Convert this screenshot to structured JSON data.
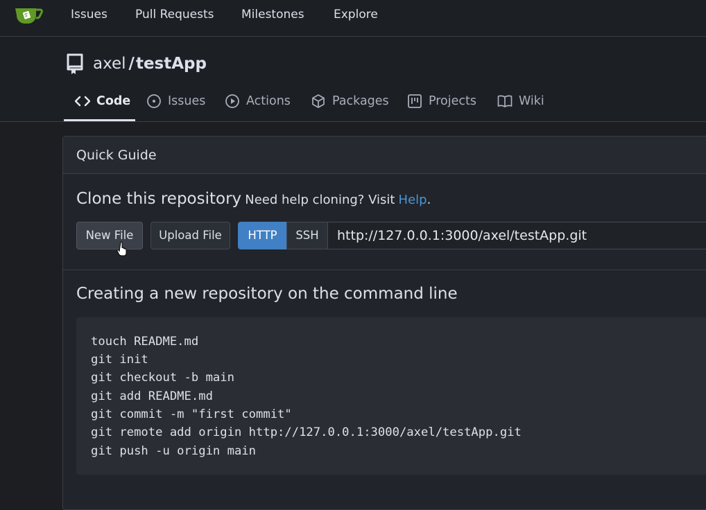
{
  "topnav": {
    "items": [
      "Issues",
      "Pull Requests",
      "Milestones",
      "Explore"
    ]
  },
  "repo": {
    "owner": "axel",
    "separator": "/",
    "name": "testApp"
  },
  "tabs": [
    {
      "label": "Code",
      "icon": "code-icon",
      "active": true
    },
    {
      "label": "Issues",
      "icon": "issue-icon",
      "active": false
    },
    {
      "label": "Actions",
      "icon": "play-icon",
      "active": false
    },
    {
      "label": "Packages",
      "icon": "package-icon",
      "active": false
    },
    {
      "label": "Projects",
      "icon": "project-icon",
      "active": false
    },
    {
      "label": "Wiki",
      "icon": "book-icon",
      "active": false
    }
  ],
  "quick_guide": {
    "title": "Quick Guide",
    "clone_title": "Clone this repository",
    "clone_help_text": "Need help cloning? Visit",
    "clone_help_link": "Help",
    "clone_help_period": ".",
    "new_file_label": "New File",
    "upload_file_label": "Upload File",
    "http_label": "HTTP",
    "ssh_label": "SSH",
    "clone_url": "http://127.0.0.1:3000/axel/testApp.git",
    "cmdline_title": "Creating a new repository on the command line",
    "commands": [
      "touch README.md",
      "git init",
      "git checkout -b main",
      "git add README.md",
      "git commit -m \"first commit\"",
      "git remote add origin http://127.0.0.1:3000/axel/testApp.git",
      "git push -u origin main"
    ]
  },
  "colors": {
    "accent": "#4180c4",
    "link": "#4b95d6",
    "logo_green": "#609926"
  }
}
